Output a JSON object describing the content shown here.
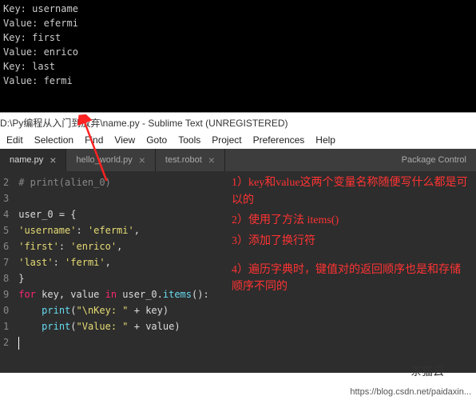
{
  "terminal": {
    "lines": [
      "Key: username",
      "Value: efermi",
      "",
      "Key: first",
      "Value: enrico",
      "",
      "Key: last",
      "Value: fermi"
    ]
  },
  "title_bar": "D:\\Py编程从入门到放弃\\name.py - Sublime Text (UNREGISTERED)",
  "menu": [
    "Edit",
    "Selection",
    "Find",
    "View",
    "Goto",
    "Tools",
    "Project",
    "Preferences",
    "Help"
  ],
  "tabs": [
    {
      "label": "name.py",
      "active": true,
      "close": "×"
    },
    {
      "label": "hello_world.py",
      "active": false,
      "close": "×"
    },
    {
      "label": "test.robot",
      "active": false,
      "close": "×"
    },
    {
      "label": "Package Control",
      "active": false,
      "close": ""
    }
  ],
  "gutter": [
    "2",
    "3",
    "4",
    "5",
    "6",
    "7",
    "8",
    "9",
    "0",
    "1",
    "2"
  ],
  "code": {
    "l0_comment": "# print(alien_0)",
    "l2_var": "user_0",
    "l2_op": " = {",
    "l3_k": "'username'",
    "l3_v": "'efermi'",
    "l4_k": "'first'",
    "l4_v": "'enrico'",
    "l5_k": "'last'",
    "l5_v": "'fermi'",
    "l6": "}",
    "l7_for": "for",
    "l7_vars": " key, value ",
    "l7_in": "in",
    "l7_obj": " user_0.",
    "l7_fn": "items",
    "l7_end": "():",
    "l8_fn": "print",
    "l8_arg1": "\"\\nKey: \"",
    "l8_op": " + key)",
    "l9_fn": "print",
    "l9_arg1": "\"Value: \"",
    "l9_op": " + value)"
  },
  "annotations": {
    "a1": "1）key和value这两个变量名称随便写什么都是可以的",
    "a2": "2）使用了方法 items()",
    "a3": "3）添加了换行符",
    "a4": "4）遍历字典时，键值对的返回顺序也是和存储顺序不同的"
  },
  "watermark": "茶猫云",
  "footer_url": "https://blog.csdn.net/paidaxin..."
}
